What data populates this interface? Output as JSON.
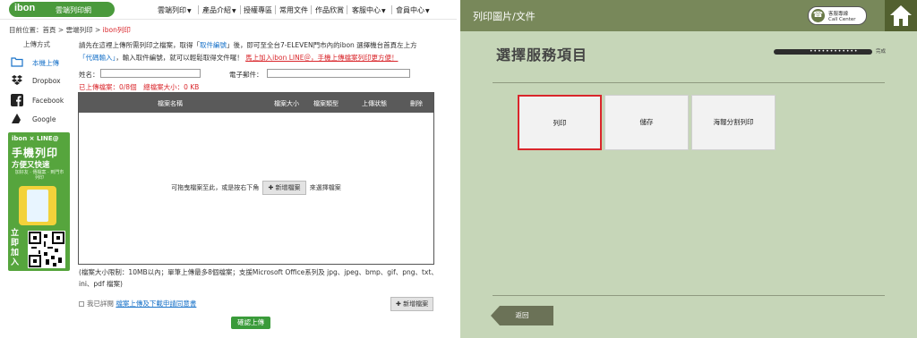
{
  "left": {
    "logo": {
      "word": "ibon",
      "sub": "雲端列印網"
    },
    "nav": [
      "雲端列印",
      "產品介紹",
      "授權專區",
      "常用文件",
      "作品欣賞",
      "客服中心",
      "會員中心"
    ],
    "breadcrumb": {
      "prefix": "目前位置：",
      "home": "首頁",
      "sep": ">",
      "level2": "雲端列印",
      "current": "ibon列印"
    },
    "side": {
      "title": "上傳方式",
      "items": [
        {
          "label": "本機上傳",
          "icon": "folder-icon"
        },
        {
          "label": "Dropbox",
          "icon": "dropbox-icon"
        },
        {
          "label": "Facebook",
          "icon": "facebook-icon"
        },
        {
          "label": "Google",
          "icon": "google-icon"
        }
      ]
    },
    "banner": {
      "line1": "ibon × LINE@",
      "line2": "手機列印",
      "line3": "方便又快速",
      "line4": "加好友 · 傳檔案 · 到門市列印",
      "side": "立即加入"
    },
    "intro": {
      "p1": "請先在這裡上傳所需列印之檔案，取得「",
      "pickup": "取件編號",
      "p2": "」後，即可至全台7-ELEVEN門市內的ibon 選擇機台首頁左上方",
      "proxy": "「代碼輸入」",
      "p3": "，輸入取件編號，就可以輕鬆取得文件囉！",
      "line_link": "馬上加入ibon LINE＠，手機上傳檔案列印更方便！"
    },
    "form": {
      "name_label": "姓名：",
      "email_label": "電子郵件：",
      "name_value": "",
      "email_value": ""
    },
    "stats": "已上傳檔案：0/8個　總檔案大小：0 KB",
    "table": {
      "headers": [
        "檔案名稱",
        "檔案大小",
        "檔案類型",
        "上傳狀態",
        "刪除"
      ],
      "drop_pre": "可拖曳檔案至此，或是按右下角",
      "add_label": "✚ 新增檔案",
      "drop_post": "來選擇檔案"
    },
    "note": "(檔案大小限制：10MB以內；單筆上傳最多8個檔案；支援Microsoft Office系列及 jpg、jpeg、bmp、gif、png、txt、ini、pdf 檔案)",
    "agree": {
      "text": "我已詳閱",
      "link": "檔案上傳及下載申請同意書"
    },
    "add_button": "✚ 新增檔案",
    "confirm_button": "確認上傳"
  },
  "right": {
    "header_title": "列印圖片/文件",
    "call_center": {
      "line1": "客服專線",
      "line2": "Call Center"
    },
    "page_title": "選擇服務項目",
    "progress_label": "完成",
    "services": [
      "列印",
      "儲存",
      "海報分割列印"
    ],
    "selected_service": "列印",
    "back_button": "返回"
  }
}
